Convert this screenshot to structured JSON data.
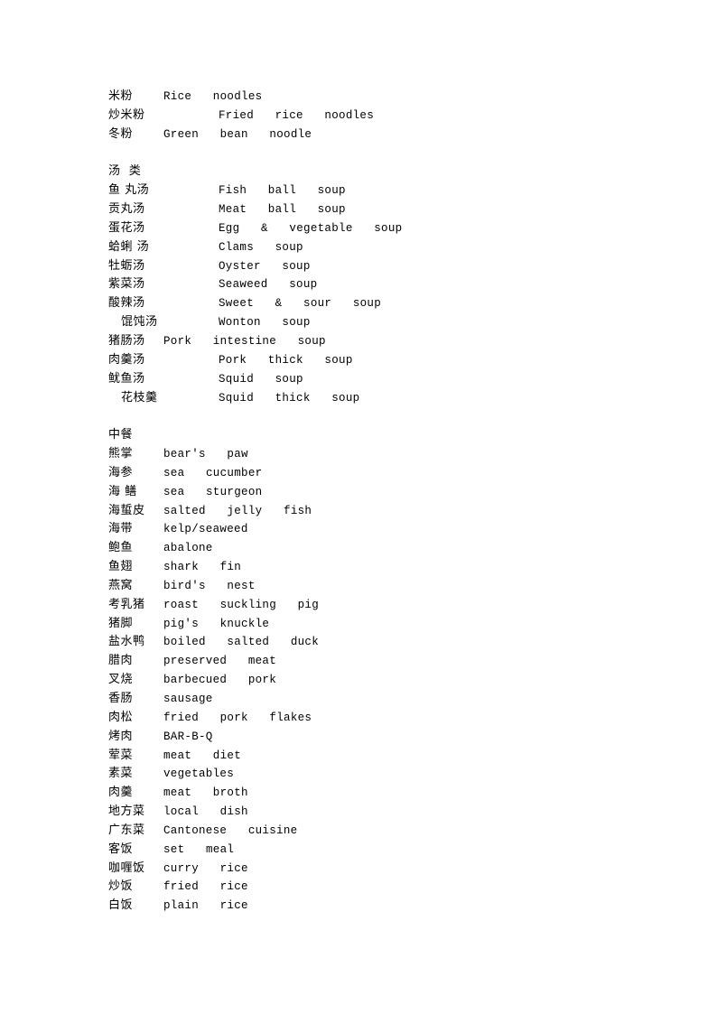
{
  "sections": {
    "noodles": {
      "items": [
        {
          "zh": "米粉",
          "en": "Rice  noodles",
          "col": 1
        },
        {
          "zh": "炒米粉",
          "en": "Fried  rice  noodles",
          "col": 2
        },
        {
          "zh": "冬粉",
          "en": "Green  bean  noodle",
          "col": 1
        }
      ]
    },
    "soups": {
      "heading": "汤  类",
      "items": [
        {
          "zh": "鱼 丸汤",
          "en": "Fish  ball  soup",
          "col": 2
        },
        {
          "zh": "贡丸汤",
          "en": "Meat  ball  soup",
          "col": 2
        },
        {
          "zh": "蛋花汤",
          "en": "Egg  &  vegetable  soup",
          "col": 2
        },
        {
          "zh": "蛤蜊 汤",
          "en": "Clams  soup",
          "col": 2
        },
        {
          "zh": "牡蛎汤",
          "en": "Oyster  soup",
          "col": 2
        },
        {
          "zh": "紫菜汤",
          "en": "Seaweed  soup",
          "col": 2
        },
        {
          "zh": "酸辣汤",
          "en": "Sweet  &  sour  soup",
          "col": 2
        },
        {
          "zh": "馄饨汤",
          "en": "Wonton  soup",
          "col": 2,
          "indent": true
        },
        {
          "zh": "猪肠汤",
          "en": "Pork  intestine  soup",
          "col": 1
        },
        {
          "zh": "肉羹汤",
          "en": "Pork  thick  soup",
          "col": 2
        },
        {
          "zh": "鱿鱼汤",
          "en": "Squid  soup",
          "col": 2
        },
        {
          "zh": "花枝羹",
          "en": "Squid  thick  soup",
          "col": 2,
          "indent": true
        }
      ]
    },
    "chinese_meals": {
      "heading": "中餐",
      "items": [
        {
          "zh": "熊掌",
          "en": "bear's  paw"
        },
        {
          "zh": "海参",
          "en": "sea  cucumber"
        },
        {
          "zh": "海 鳝",
          "en": "sea  sturgeon"
        },
        {
          "zh": "海蜇皮",
          "en": "salted  jelly  fish"
        },
        {
          "zh": "海带",
          "en": "kelp/seaweed"
        },
        {
          "zh": "鲍鱼",
          "en": "abalone"
        },
        {
          "zh": "鱼翅",
          "en": "shark  fin"
        },
        {
          "zh": "燕窝",
          "en": "bird's  nest"
        },
        {
          "zh": "考乳猪",
          "en": "roast  suckling  pig"
        },
        {
          "zh": "猪脚",
          "en": "pig's  knuckle"
        },
        {
          "zh": "盐水鸭",
          "en": "boiled  salted  duck"
        },
        {
          "zh": "腊肉",
          "en": "preserved  meat"
        },
        {
          "zh": "叉烧",
          "en": "barbecued  pork"
        },
        {
          "zh": "香肠",
          "en": "sausage"
        },
        {
          "zh": "肉松",
          "en": "fried  pork  flakes"
        },
        {
          "zh": "烤肉",
          "en": "BAR-B-Q"
        },
        {
          "zh": "荤菜",
          "en": "meat  diet"
        },
        {
          "zh": "素菜",
          "en": "vegetables"
        },
        {
          "zh": "肉羹",
          "en": "meat  broth"
        },
        {
          "zh": "地方菜",
          "en": "local  dish"
        },
        {
          "zh": "广东菜",
          "en": "Cantonese  cuisine"
        },
        {
          "zh": "客饭",
          "en": "set  meal"
        },
        {
          "zh": "咖喱饭",
          "en": "curry  rice"
        },
        {
          "zh": "炒饭",
          "en": "fried  rice"
        },
        {
          "zh": "白饭",
          "en": "plain  rice"
        }
      ]
    }
  }
}
